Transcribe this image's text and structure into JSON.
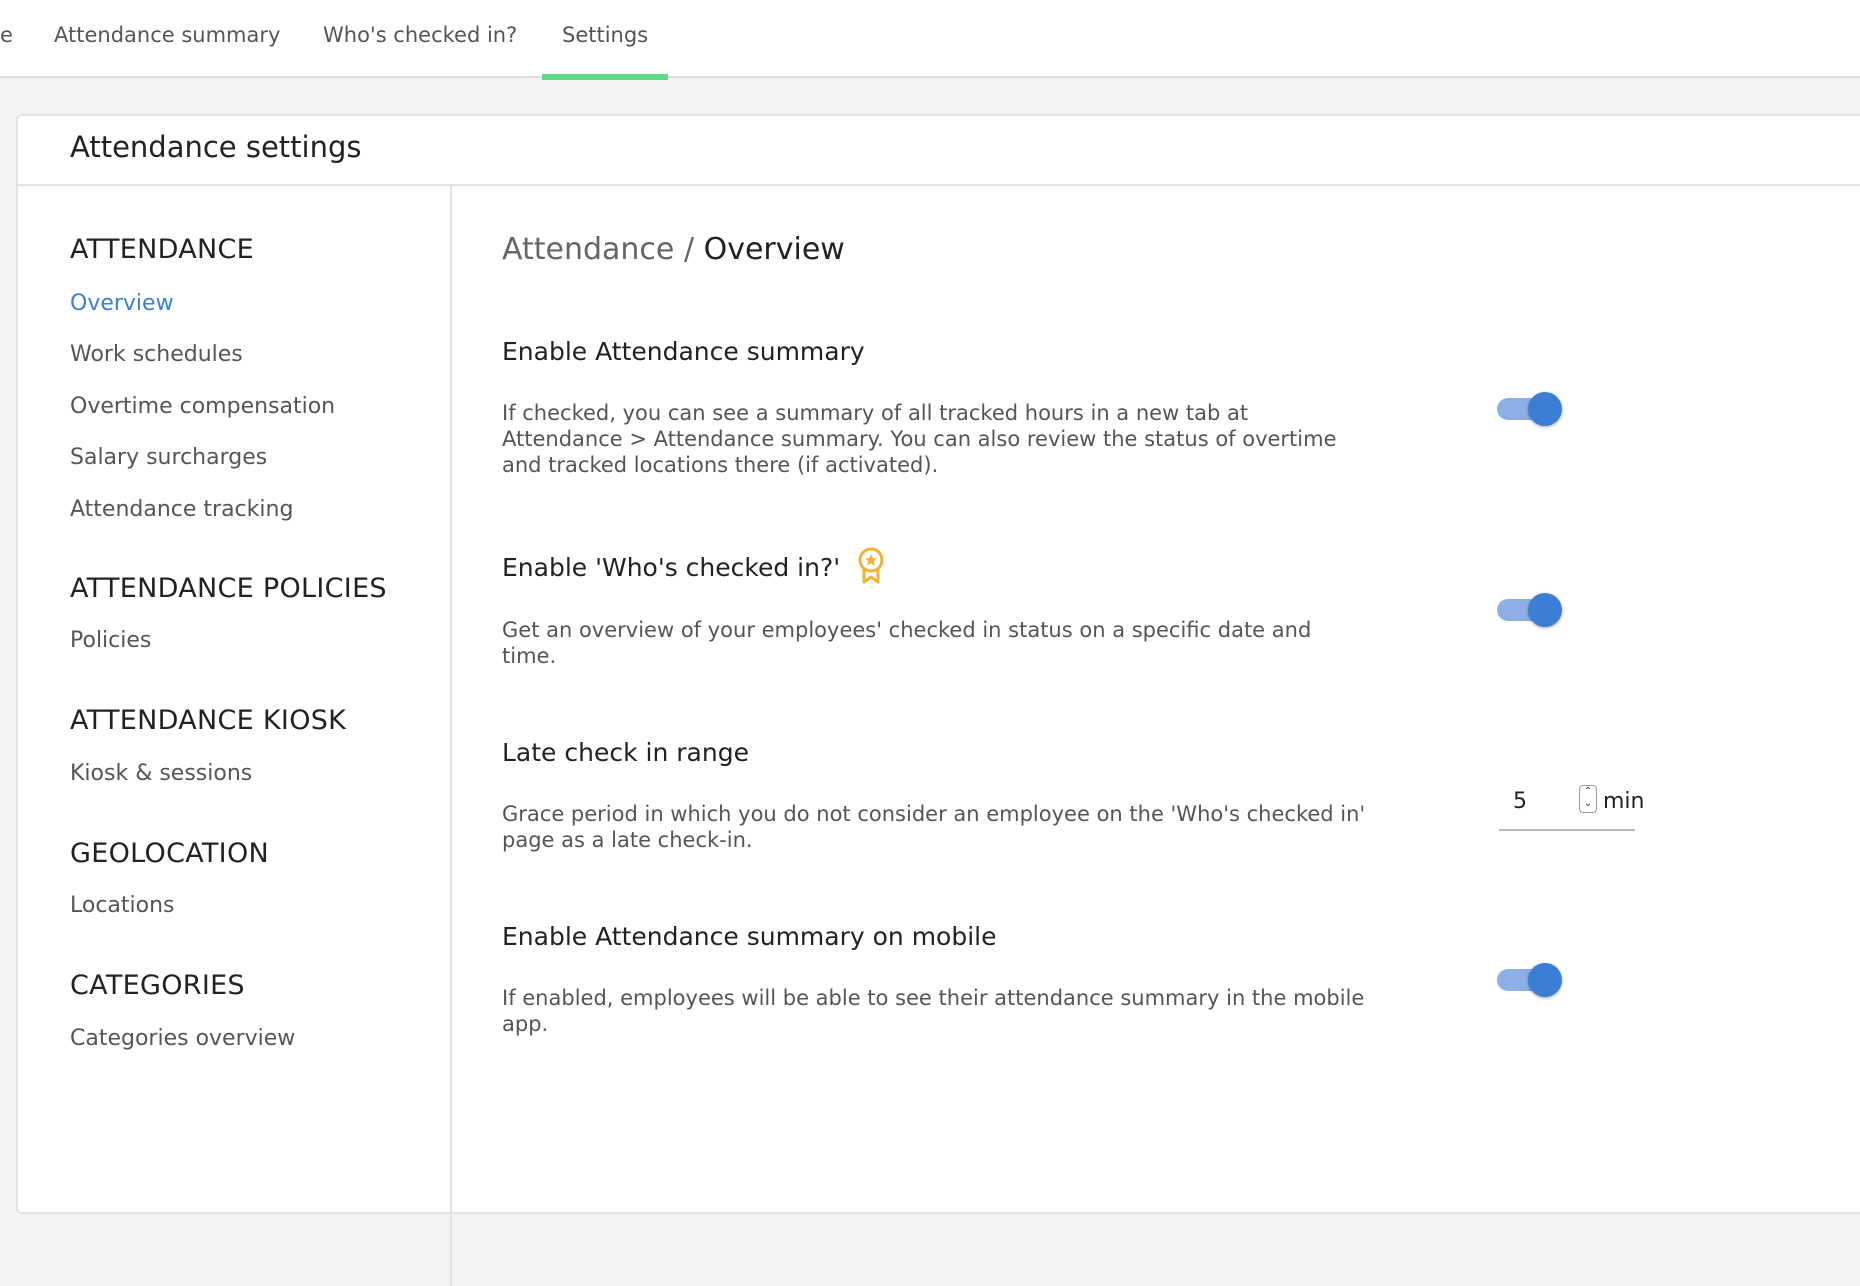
{
  "tabs": {
    "cut": "e",
    "summary": "Attendance summary",
    "checked_in": "Who's checked in?",
    "settings": "Settings"
  },
  "card": {
    "title": "Attendance settings"
  },
  "sidebar": {
    "sections": [
      {
        "heading": "ATTENDANCE",
        "items": [
          "Overview",
          "Work schedules",
          "Overtime compensation",
          "Salary surcharges",
          "Attendance tracking"
        ]
      },
      {
        "heading": "ATTENDANCE POLICIES",
        "items": [
          "Policies"
        ]
      },
      {
        "heading": "ATTENDANCE KIOSK",
        "items": [
          "Kiosk & sessions"
        ]
      },
      {
        "heading": "GEOLOCATION",
        "items": [
          "Locations"
        ]
      },
      {
        "heading": "CATEGORIES",
        "items": [
          "Categories overview"
        ]
      }
    ],
    "active_item": "Overview"
  },
  "main": {
    "breadcrumb": {
      "parent": "Attendance",
      "separator": "/",
      "current": "Overview"
    },
    "settings": [
      {
        "title": "Enable Attendance summary",
        "description": "If checked, you can see a summary of all tracked hours in a new tab at Attendance > Attendance summary. You can also review the status of overtime and tracked locations there (if activated).",
        "enabled": true
      },
      {
        "title": "Enable 'Who's checked in?'",
        "badge_icon": "premium-badge-icon",
        "description": "Get an overview of your employees' checked in status on a specific date and time.",
        "enabled": true
      },
      {
        "title": "Late check in range",
        "description": "Grace period in which you do not consider an employee on the 'Who's checked in' page as a late check-in.",
        "value": "5",
        "unit": "min"
      },
      {
        "title": "Enable Attendance summary on mobile",
        "description": "If enabled, employees will be able to see their attendance summary in the mobile app.",
        "enabled": true
      }
    ]
  },
  "colors": {
    "accent": "#3a7fd5",
    "tab_indicator": "#5dd887",
    "badge": "#f2b233"
  }
}
